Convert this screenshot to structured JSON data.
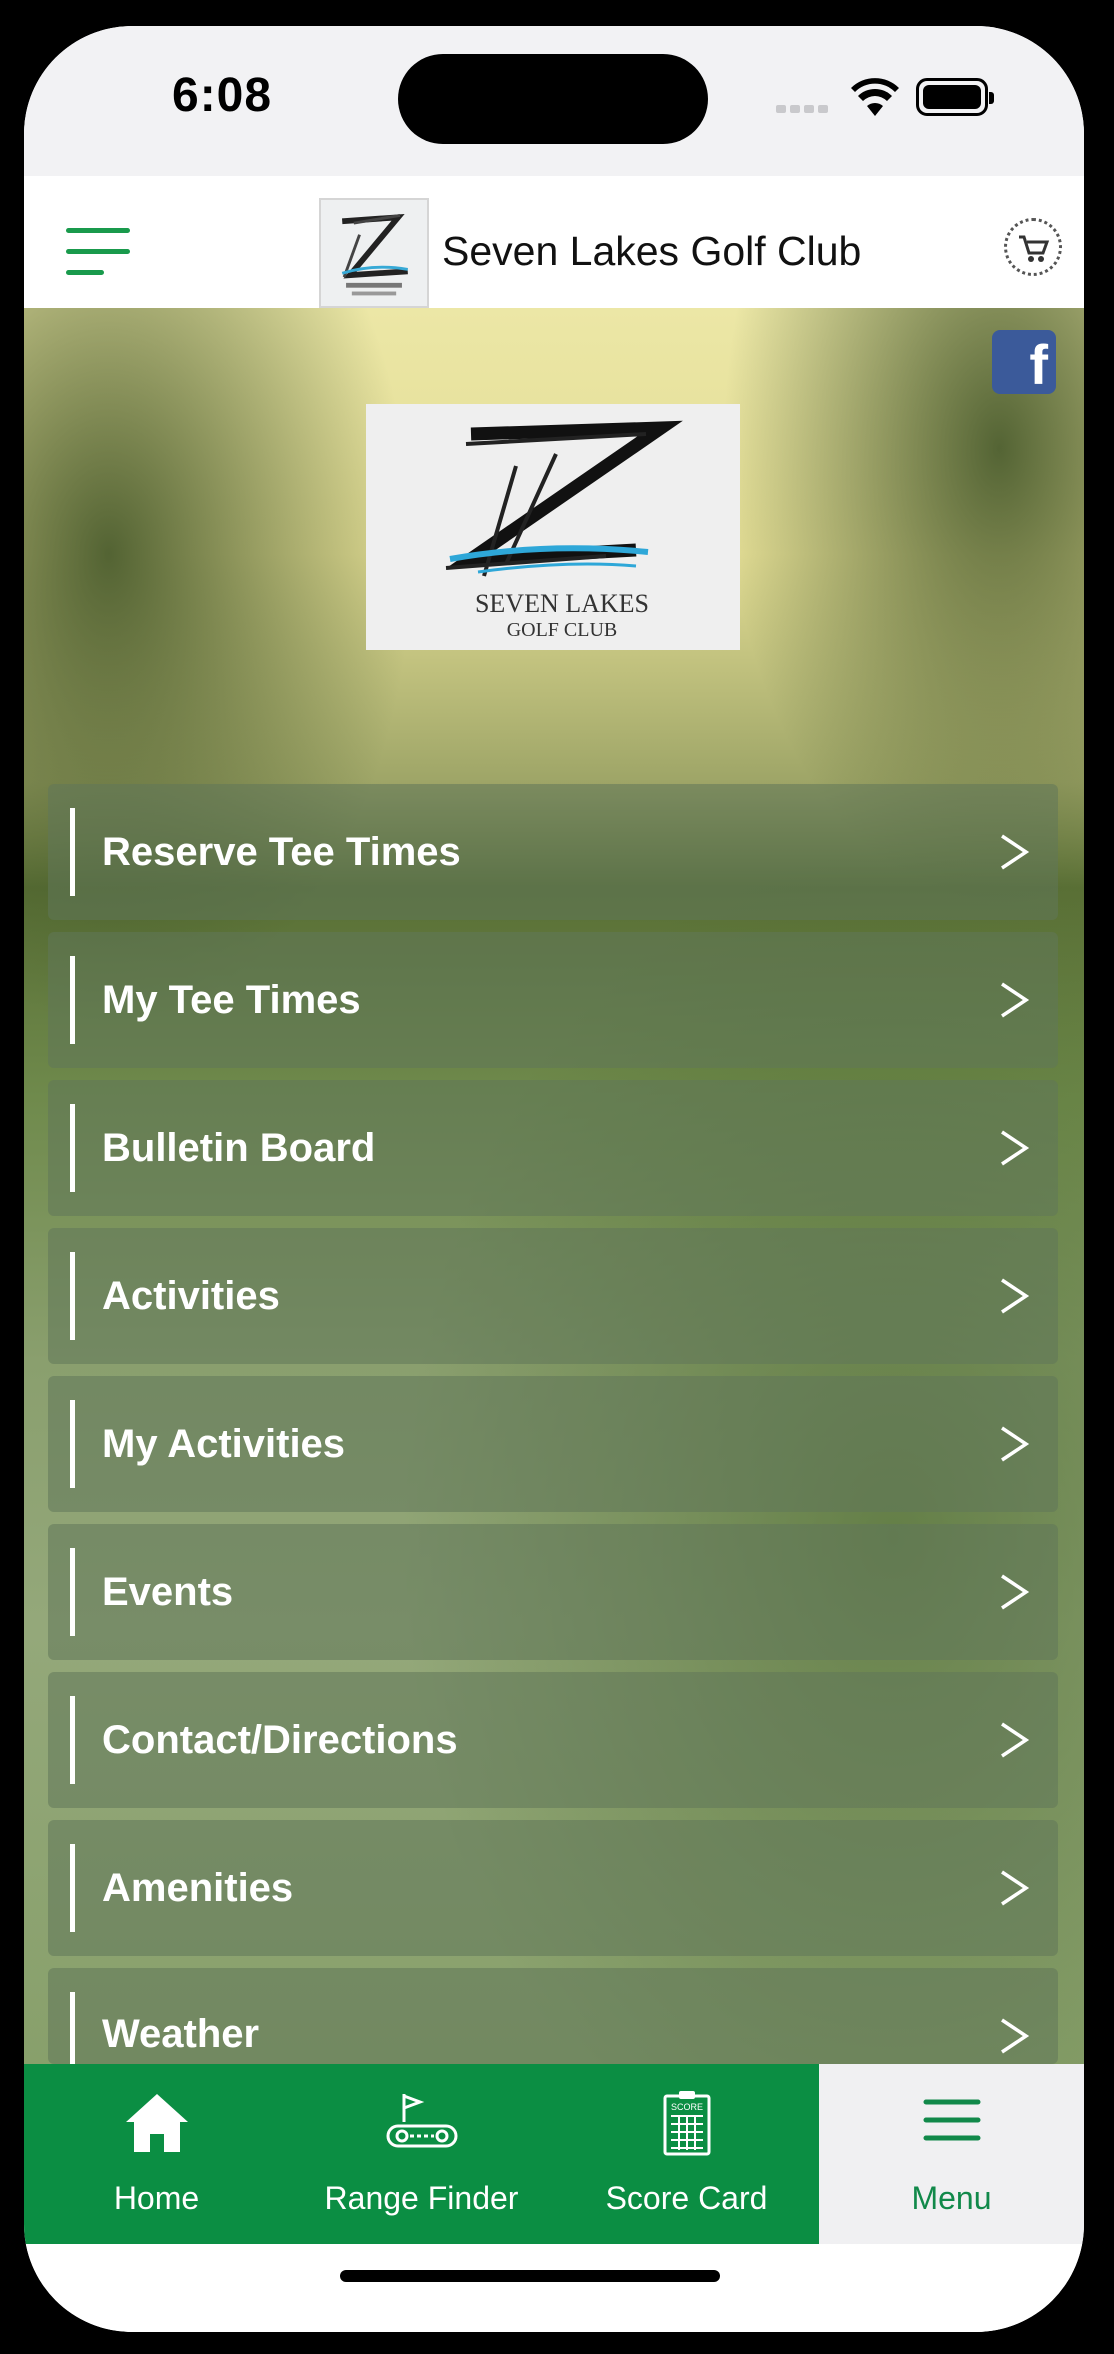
{
  "status": {
    "time": "6:08"
  },
  "header": {
    "title": "Seven Lakes Golf Club"
  },
  "brand": {
    "line1": "SEVEN LAKES",
    "line2": "GOLF CLUB"
  },
  "social": {
    "facebook": "f"
  },
  "menu": [
    {
      "label": "Reserve Tee Times"
    },
    {
      "label": "My Tee Times"
    },
    {
      "label": "Bulletin Board"
    },
    {
      "label": "Activities"
    },
    {
      "label": "My Activities"
    },
    {
      "label": "Events"
    },
    {
      "label": "Contact/Directions"
    },
    {
      "label": "Amenities"
    },
    {
      "label": "Weather"
    }
  ],
  "tabs": [
    {
      "label": "Home",
      "icon": "home-icon"
    },
    {
      "label": "Range  Finder",
      "icon": "golf-cart-icon"
    },
    {
      "label": "Score  Card",
      "icon": "scorecard-icon",
      "icon_text": "SCORE"
    },
    {
      "label": "Menu",
      "icon": "menu-icon"
    }
  ],
  "colors": {
    "brand_green": "#0b8e43",
    "accent_green": "#199a4c",
    "facebook_blue": "#3b5a9a"
  }
}
